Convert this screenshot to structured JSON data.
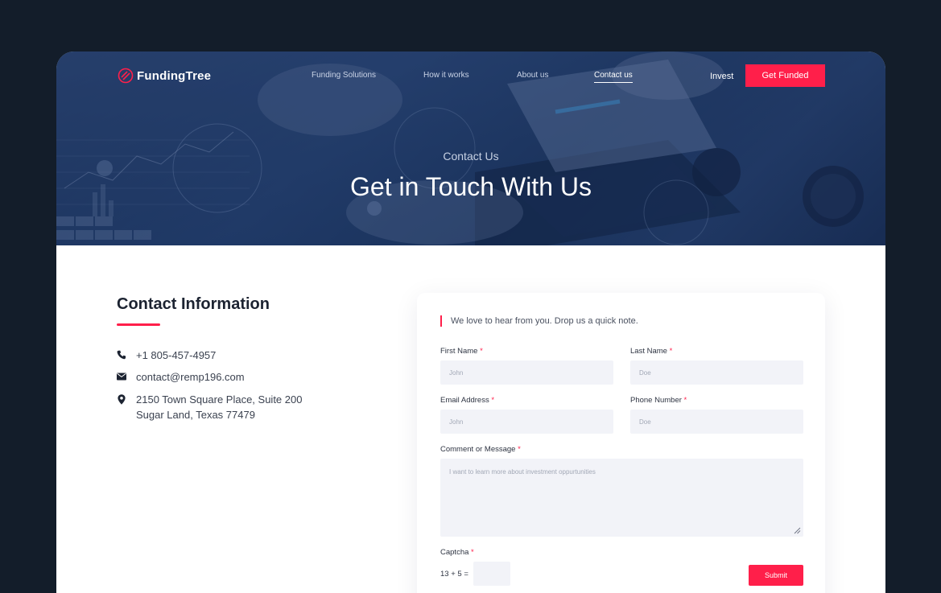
{
  "brand": {
    "name": "FundingTree"
  },
  "nav": {
    "links": [
      "Funding Solutions",
      "How it works",
      "About us",
      "Contact us"
    ],
    "active": "Contact us",
    "invest_label": "Invest",
    "cta_label": "Get Funded"
  },
  "hero": {
    "subtitle": "Contact Us",
    "title": "Get in Touch With Us"
  },
  "contact_info": {
    "title": "Contact Information",
    "phone": "+1 805-457-4957",
    "email": "contact@remp196.com",
    "address_line1": "2150 Town Square Place, Suite 200",
    "address_line2": "Sugar Land, Texas 77479"
  },
  "form": {
    "note": "We love to hear from you. Drop us a quick note.",
    "required_mark": "*",
    "first_name": {
      "label": "First Name",
      "placeholder": "John"
    },
    "last_name": {
      "label": "Last Name",
      "placeholder": "Doe"
    },
    "email": {
      "label": "Email Address",
      "placeholder": "John"
    },
    "phone": {
      "label": "Phone Number",
      "placeholder": "Doe"
    },
    "message": {
      "label": "Comment or Message",
      "placeholder": "I want to learn more about investment oppurtunities"
    },
    "captcha": {
      "label": "Captcha",
      "question": "13 + 5 =",
      "value": ""
    },
    "submit_label": "Submit"
  },
  "colors": {
    "accent": "#ff1f4a",
    "hero": "#1f3a66",
    "outer_bg": "#131d2a",
    "input_bg": "#f2f3f8"
  },
  "icons": [
    "logo-mark-icon",
    "phone-icon",
    "mail-icon",
    "location-pin-icon",
    "resize-handle-icon"
  ]
}
